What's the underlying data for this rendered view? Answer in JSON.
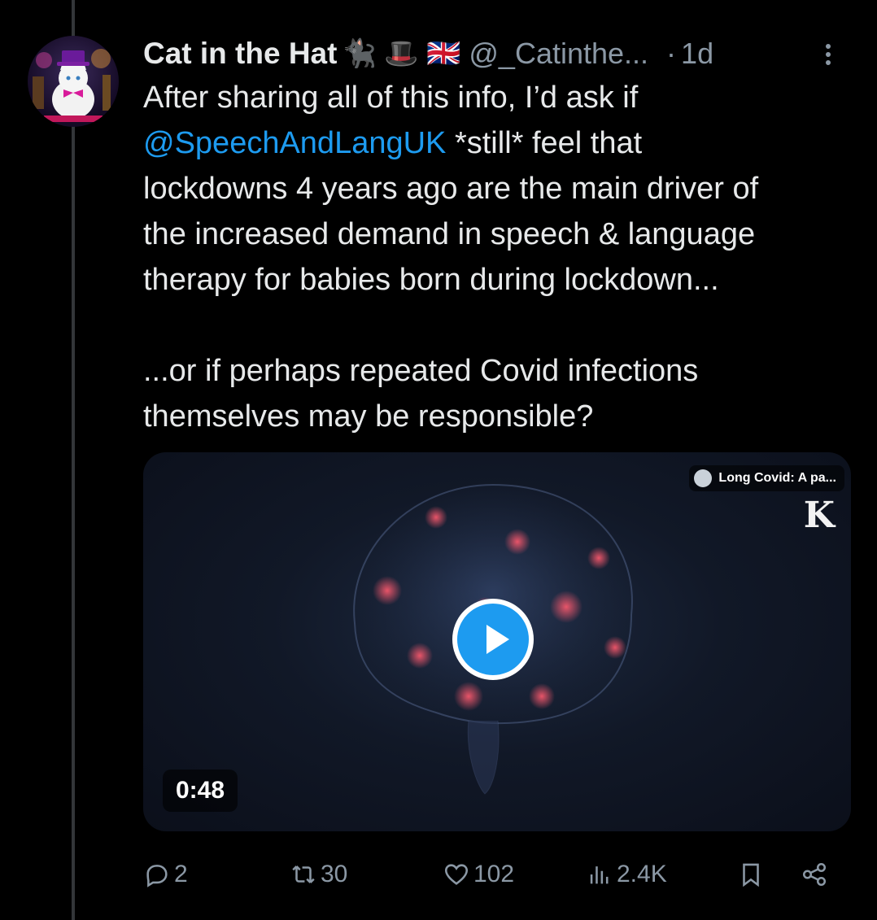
{
  "tweet": {
    "author_name": "Cat in the Hat",
    "author_emojis": "🐈‍⬛ 🎩 🇬🇧",
    "handle": "@_Catinthe...",
    "dot": "·",
    "time": "1d",
    "text_line1": "After sharing all of this info, I’d ask if",
    "mention": "@SpeechAndLangUK",
    "text_line2_rest": " *still* feel that",
    "text_line3": "lockdowns 4 years ago are the main driver of",
    "text_line4": "the increased demand in speech & language",
    "text_line5": "therapy for babies born during lockdown...",
    "text_line6": "...or if perhaps repeated Covid infections",
    "text_line7": "themselves may be responsible?"
  },
  "media": {
    "source_title": "Long Covid: A pa...",
    "logo": "K",
    "duration": "0:48",
    "accent": "#1d9bf0"
  },
  "actions": {
    "replies": "2",
    "reposts": "30",
    "likes": "102",
    "views": "2.4K"
  }
}
